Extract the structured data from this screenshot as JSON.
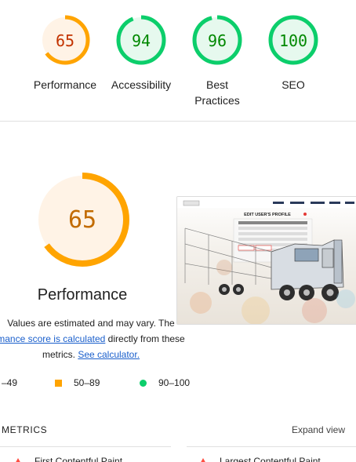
{
  "categories": [
    {
      "score": "65",
      "label": "Performance",
      "value": 65,
      "color": "#ffa400",
      "text_color": "#c33300",
      "bg": "#fff3e6"
    },
    {
      "score": "94",
      "label": "Accessibility",
      "value": 94,
      "color": "#0cce6b",
      "text_color": "#008800",
      "bg": "#e6f9ee"
    },
    {
      "score": "96",
      "label": "Best Practices",
      "value": 96,
      "color": "#0cce6b",
      "text_color": "#008800",
      "bg": "#e6f9ee"
    },
    {
      "score": "100",
      "label": "SEO",
      "value": 100,
      "color": "#0cce6b",
      "text_color": "#008800",
      "bg": "#e6f9ee"
    }
  ],
  "main": {
    "score": "65",
    "value": 65,
    "title": "Performance",
    "color": "#ffa400",
    "text_color": "#c26b00",
    "bg": "#fff3e6",
    "desc_line1": "Values are estimated and may vary. The",
    "desc_link1": "mance score is calculated",
    "desc_after_link1": " directly from these",
    "desc_line3_prefix": "metrics. ",
    "desc_link2": "See calculator."
  },
  "thumbnail": {
    "heading": "EDIT USER'S PROFILE"
  },
  "legend": {
    "fail": "–49",
    "average": "50–89",
    "pass": "90–100"
  },
  "metrics": {
    "title": "METRICS",
    "expand": "Expand view",
    "items": [
      {
        "label": "First Contentful Paint"
      },
      {
        "label": "Largest Contentful Paint"
      }
    ]
  }
}
